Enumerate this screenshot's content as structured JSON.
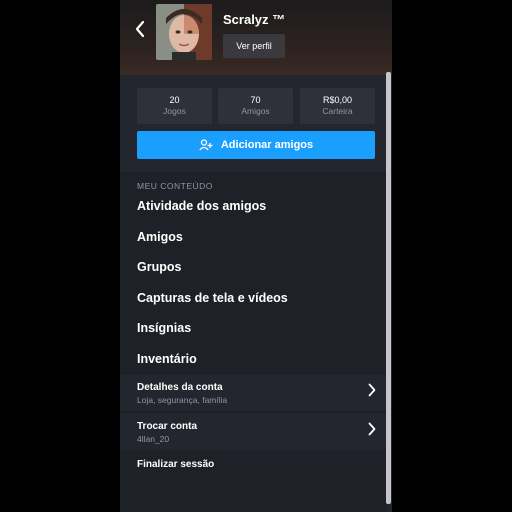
{
  "header": {
    "username": "Scralyz ™",
    "view_profile_label": "Ver perfil"
  },
  "stats": [
    {
      "value": "20",
      "label": "Jogos"
    },
    {
      "value": "70",
      "label": "Amigos"
    },
    {
      "value": "R$0,00",
      "label": "Carteira"
    }
  ],
  "add_friends_label": "Adicionar amigos",
  "content": {
    "section_label": "MEU CONTEÚDO",
    "items": [
      "Atividade dos amigos",
      "Amigos",
      "Grupos",
      "Capturas de tela e vídeos",
      "Insígnias",
      "Inventário"
    ],
    "account_details": {
      "title": "Detalhes da conta",
      "subtitle": "Loja, segurança, família"
    },
    "switch_account": {
      "title": "Trocar conta",
      "subtitle": "4llan_20"
    },
    "logout_label": "Finalizar sessão"
  },
  "colors": {
    "accent": "#1a9fff",
    "background": "#1f2128",
    "panel": "#23262e",
    "muted_text": "#8f98a0"
  }
}
